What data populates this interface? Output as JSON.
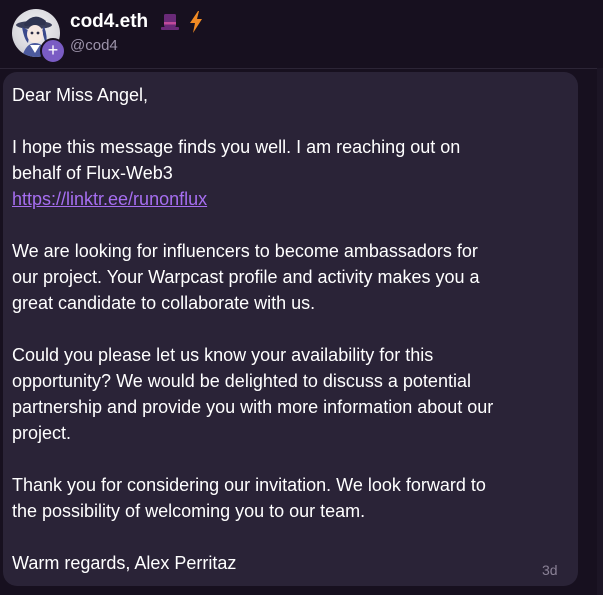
{
  "header": {
    "display_name": "cod4.eth",
    "username": "@cod4",
    "badges": [
      "top-hat-icon",
      "lightning-bolt-icon"
    ],
    "follow_symbol": "+"
  },
  "message": {
    "greeting": "Dear Miss Angel,",
    "intro_line1": "I hope this message finds you well. I am reaching out on",
    "intro_line2": "behalf of Flux-Web3",
    "link": "https://linktr.ee/runonflux",
    "para2_line1": "We are looking for influencers to become ambassadors for",
    "para2_line2": "our project. Your Warpcast profile and activity makes you a",
    "para2_line3": "great candidate to collaborate with us.",
    "para3_line1": "Could you please let us know your availability for this",
    "para3_line2": "opportunity? We would be delighted to discuss a potential",
    "para3_line3": "partnership and provide you with more information about our",
    "para3_line4": "project.",
    "para4_line1": "Thank you for considering our invitation. We look forward to",
    "para4_line2": "the possibility of welcoming you to our team.",
    "signoff": "Warm regards, Alex Perritaz",
    "timestamp": "3d"
  },
  "colors": {
    "background": "#17101f",
    "bubble": "#2a2337",
    "link": "#a66ef0",
    "accent": "#7a5cc4",
    "bolt": "#f08a24"
  }
}
